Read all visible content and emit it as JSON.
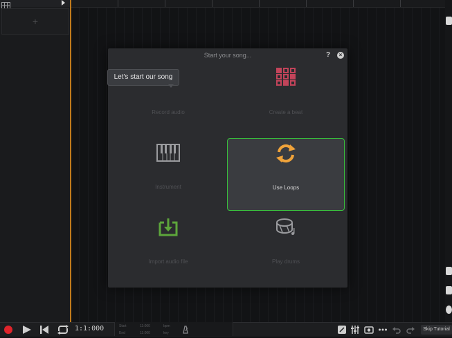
{
  "dialog": {
    "title": "Start your song...",
    "help": "?",
    "close": "×"
  },
  "options": {
    "record_audio": "Record audio",
    "create_beat": "Create a beat",
    "instrument": "Instrument",
    "use_loops": "Use Loops",
    "import_audio": "Import audio file",
    "play_drums": "Play drums"
  },
  "tooltip": {
    "text": "Let's start our song"
  },
  "left_panel": {
    "add_label": "+"
  },
  "transport": {
    "time": "1:1:000",
    "start_label": "Start",
    "start_value": "11:000",
    "end_label": "End",
    "end_value": "11:000",
    "bpm_label": "bpm",
    "key_label": "key",
    "skip_tutorial": "Skip Tutorial"
  },
  "colors": {
    "accent_green": "#39c03d",
    "record_red": "#e0242b",
    "loops_orange": "#f0a33a",
    "drum_pink": "#c2445a",
    "record_blue": "#2f8fd3",
    "import_green": "#5da63b",
    "playhead": "#c07a1c"
  }
}
